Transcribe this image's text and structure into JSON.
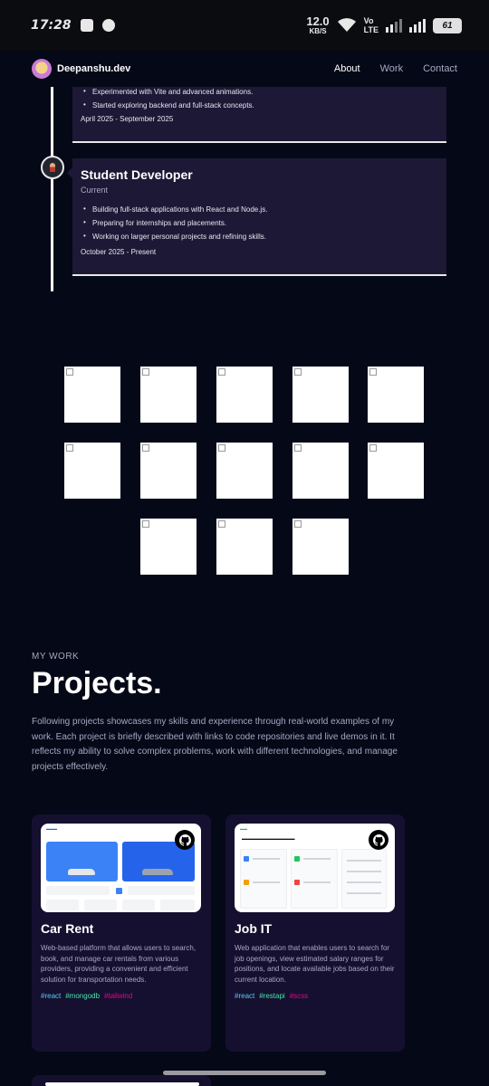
{
  "status_bar": {
    "time": "17:28",
    "net_speed_value": "12.0",
    "net_speed_unit": "KB/S",
    "volte_line1": "Vo",
    "volte_line2": "LTE",
    "battery": "61"
  },
  "navbar": {
    "brand": "Deepanshu.dev",
    "links": [
      "About",
      "Work",
      "Contact"
    ],
    "active": "About"
  },
  "experience": [
    {
      "title": "",
      "subtitle": "",
      "points": [
        "Experimented with Vite and advanced animations.",
        "Started exploring backend and full-stack concepts."
      ],
      "date": "April 2025 - September 2025"
    },
    {
      "title": "Student Developer",
      "subtitle": "Current",
      "points": [
        "Building full-stack applications with React and Node.js.",
        "Preparing for internships and placements.",
        "Working on larger personal projects and refining skills."
      ],
      "date": "October 2025 - Present"
    }
  ],
  "tech_icons_count": 13,
  "works": {
    "subtext": "MY WORK",
    "heading": "Projects.",
    "intro": "Following projects showcases my skills and experience through real-world examples of my work. Each project is briefly described with links to code repositories and live demos in it. It reflects my ability to solve complex problems, work with different technologies, and manage projects effectively."
  },
  "projects": [
    {
      "name": "Car Rent",
      "description": "Web-based platform that allows users to search, book, and manage car rentals from various providers, providing a convenient and efficient solution for transportation needs.",
      "tags": [
        {
          "name": "#react",
          "color": "#56ccf2"
        },
        {
          "name": "#mongodb",
          "color": "#47e5a8"
        },
        {
          "name": "#tailwind",
          "color": "#ec008c"
        }
      ]
    },
    {
      "name": "Job IT",
      "description": "Web application that enables users to search for job openings, view estimated salary ranges for positions, and locate available jobs based on their current location.",
      "tags": [
        {
          "name": "#react",
          "color": "#56ccf2"
        },
        {
          "name": "#restapi",
          "color": "#47e5a8"
        },
        {
          "name": "#scss",
          "color": "#ec008c"
        }
      ]
    }
  ],
  "colors": {
    "background": "#050816",
    "card": "#1d1836",
    "project_card": "#151030",
    "secondary_text": "#aaa6c3"
  }
}
